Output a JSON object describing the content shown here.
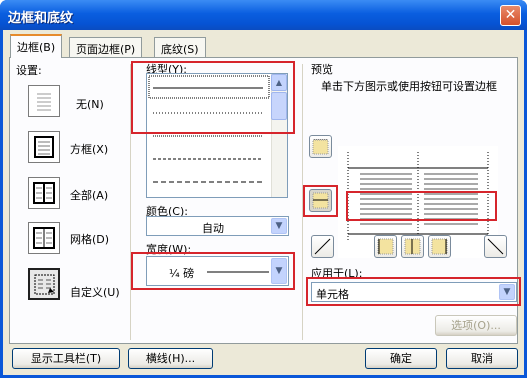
{
  "window": {
    "title": "边框和底纹",
    "close_glyph": "✕"
  },
  "tabs": [
    {
      "label": "边框(B)",
      "active": true
    },
    {
      "label": "页面边框(P)",
      "active": false
    },
    {
      "label": "底纹(S)",
      "active": false
    }
  ],
  "settings": {
    "heading": "设置:",
    "items": [
      {
        "label": "无(N)",
        "icon": "none-border-icon"
      },
      {
        "label": "方框(X)",
        "icon": "box-border-icon"
      },
      {
        "label": "全部(A)",
        "icon": "all-border-icon"
      },
      {
        "label": "网格(D)",
        "icon": "grid-border-icon"
      },
      {
        "label": "自定义(U)",
        "icon": "custom-border-icon"
      }
    ]
  },
  "line_style": {
    "heading": "线型(Y):",
    "options": [
      "solid",
      "dotted",
      "dotted-fine",
      "dashed-small",
      "dashed",
      "dash-dot"
    ]
  },
  "color": {
    "heading": "颜色(C):",
    "value": "自动"
  },
  "width": {
    "heading": "宽度(W):",
    "value": "¼ 磅"
  },
  "preview": {
    "heading": "预览",
    "hint": "单击下方图示或使用按钮可设置边框"
  },
  "apply_to": {
    "heading": "应用于(L):",
    "value": "单元格"
  },
  "buttons": {
    "options": "选项(O)...",
    "show_toolbar": "显示工具栏(T)",
    "horizontal_line": "横线(H)...",
    "ok": "确定",
    "cancel": "取消"
  },
  "colors": {
    "title_bar": "#0a5ee0",
    "dialog_bg": "#ece9d8",
    "highlight": "#d6252c"
  }
}
